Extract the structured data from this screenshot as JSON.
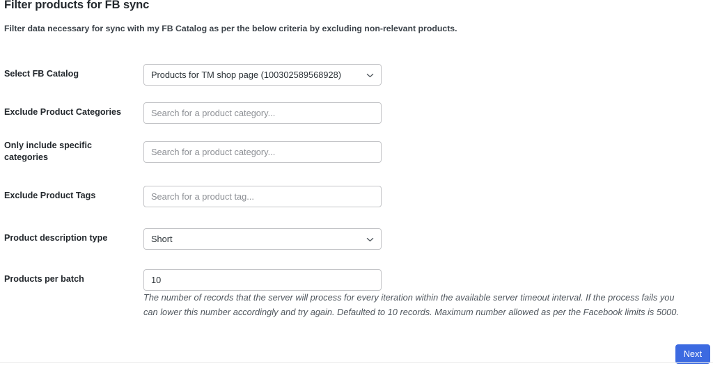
{
  "panel": {
    "title": "Filter products for FB sync",
    "subtitle": "Filter data necessary for sync with my FB Catalog as per the below criteria by excluding non-relevant products."
  },
  "form": {
    "rows": [
      {
        "label": "Select FB Catalog",
        "control": "select",
        "value": "Products for TM shop page (100302589568928)",
        "placeholder": "",
        "icon": "chevron-down-icon",
        "name": "select-fb-catalog"
      },
      {
        "label": "Exclude Product Categories",
        "control": "text",
        "value": "",
        "placeholder": "Search for a product category...",
        "icon": "",
        "name": "exclude-product-categories"
      },
      {
        "label": "Only include specific categories",
        "control": "text",
        "value": "",
        "placeholder": "Search for a product category...",
        "icon": "",
        "name": "only-include-specific-categories"
      },
      {
        "label": "Exclude Product Tags",
        "control": "text",
        "value": "",
        "placeholder": "Search for a product tag...",
        "icon": "",
        "name": "exclude-product-tags"
      },
      {
        "label": "Product description type",
        "control": "select",
        "value": "Short",
        "placeholder": "",
        "icon": "chevron-down-icon",
        "name": "product-description-type"
      },
      {
        "label": "Products per batch",
        "control": "text",
        "value": "10",
        "placeholder": "",
        "icon": "",
        "name": "products-per-batch"
      }
    ],
    "help_text": "The number of records that the server will process for every iteration within the available server timeout interval. If the process fails you can lower this number accordingly and try again. Defaulted to 10 records. Maximum number allowed as per the Facebook limits is 5000."
  },
  "footer": {
    "next_label": "Next"
  },
  "colors": {
    "accent": "#3c6ae1",
    "label_text": "#23282d",
    "placeholder_text": "#8c8f94",
    "field_border": "#c3c4c7",
    "help_text": "#50575e",
    "background": "#ffffff",
    "divider": "#ebebeb"
  }
}
